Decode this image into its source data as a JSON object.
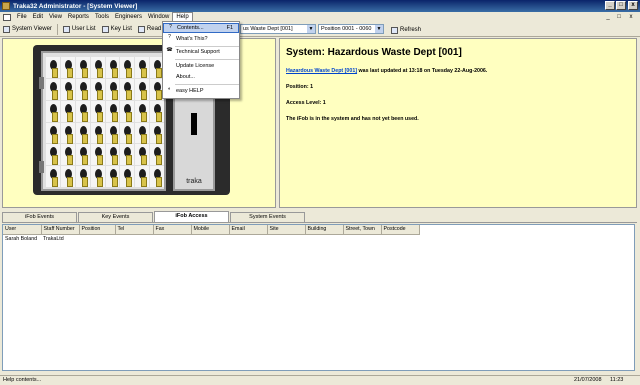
{
  "window": {
    "title": "Traka32 Administrator - [System Viewer]",
    "minimize_glyph": "_",
    "restore_glyph": "□",
    "close_glyph": "x"
  },
  "menubar": {
    "items": [
      "File",
      "Edit",
      "View",
      "Reports",
      "Tools",
      "Engineers",
      "Window",
      "Help"
    ],
    "mdi_controls": [
      "_",
      "□",
      "x"
    ]
  },
  "toolbar": {
    "system_viewer": "System Viewer",
    "user_list": "User List",
    "key_list": "Key List",
    "read_all": "Read all",
    "system_select": "us Waste Dept [001]",
    "position_select": "Position 0001 - 0060",
    "refresh": "Refresh",
    "dropdown_glyph": "▼"
  },
  "help_menu": {
    "items": [
      {
        "label": "Contents...",
        "shortcut": "F1",
        "icon": "help-book-icon",
        "glyph": "?"
      },
      {
        "label": "What's This?",
        "shortcut": "",
        "icon": "whats-this-icon",
        "glyph": "?"
      },
      {
        "label": "Technical Support",
        "shortcut": "",
        "icon": "support-icon",
        "glyph": "☎"
      },
      {
        "label": "Update License",
        "shortcut": "",
        "icon": "",
        "glyph": ""
      },
      {
        "label": "About...",
        "shortcut": "",
        "icon": "",
        "glyph": ""
      },
      {
        "label": "easy HELP",
        "shortcut": "",
        "icon": "easy-help-icon",
        "glyph": "◐"
      }
    ]
  },
  "cabinet": {
    "brand": "traka",
    "display": "888"
  },
  "details": {
    "title": "System: Hazardous Waste Dept [001]",
    "link_text": "Hazardous Waste Dept [001]",
    "updated_text": " was last updated at 13:18 on Tuesday 22-Aug-2006.",
    "position_text": "Position: 1",
    "access_text": "Access Level: 1",
    "status_text": "The iFob is in the system and has not yet been used."
  },
  "tabs": [
    "iFob Events",
    "Key Events",
    "iFob Access",
    "System Events"
  ],
  "active_tab": "iFob Access",
  "table": {
    "columns": [
      "User",
      "Staff Number",
      "Position",
      "Tel",
      "Fax",
      "Mobile",
      "Email",
      "Site",
      "Building",
      "Street, Town",
      "Postcode"
    ],
    "rows": [
      [
        "Sarah Boland",
        "TrakaLtd",
        "",
        "",
        "",
        "",
        "",
        "",
        "",
        "",
        ""
      ]
    ]
  },
  "statusbar": {
    "message": "Help contents...",
    "date": "21/07/2008",
    "time": "11:23"
  },
  "colors": {
    "panel_bg": "#ffffc0",
    "link": "#0044cc",
    "titlebar": "#0a246a",
    "menu_highlight": "#c1d2ee"
  }
}
